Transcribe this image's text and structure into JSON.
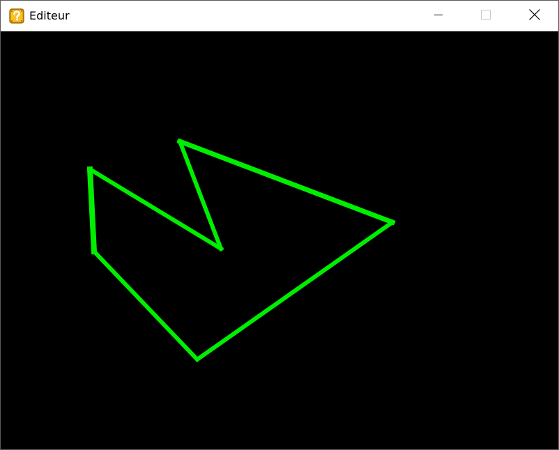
{
  "window": {
    "title": "Editeur",
    "icon": "question-block-icon",
    "controls": {
      "minimize": "minimize-icon",
      "maximize": "maximize-icon",
      "close": "close-icon"
    }
  },
  "canvas": {
    "background_color": "#000000",
    "shape": {
      "type": "polygon",
      "stroke_color": "#00ee00",
      "closed": true
    }
  }
}
